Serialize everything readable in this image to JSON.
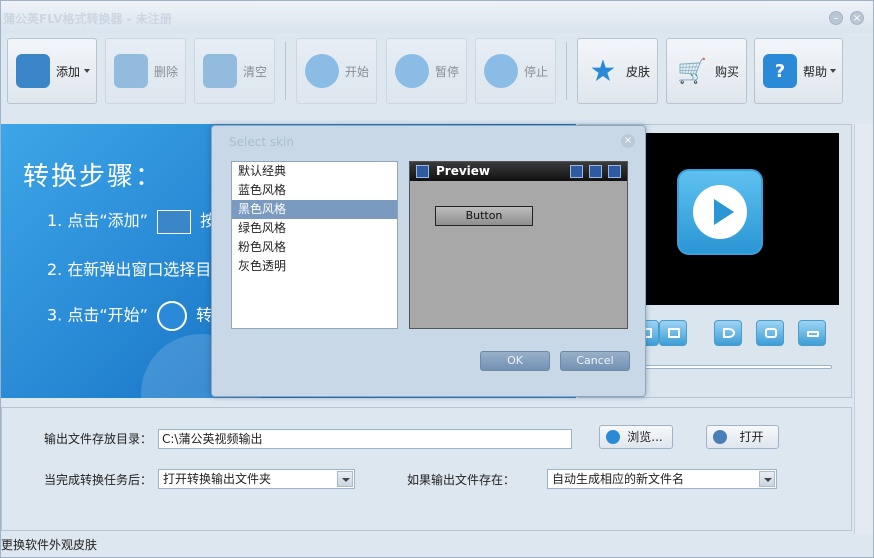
{
  "window": {
    "title": "蒲公英FLV格式转换器 - 未注册",
    "min_btn": "–",
    "close_btn": "×"
  },
  "toolbar": {
    "add": "添加",
    "delete": "删除",
    "clear": "清空",
    "start": "开始",
    "pause": "暂停",
    "stop": "停止",
    "skin": "皮肤",
    "buy": "购买",
    "help": "帮助"
  },
  "steps": {
    "title": "转换步骤：",
    "step1": "1. 点击“添加”",
    "step1_tail": "按",
    "step2": "2. 在新弹出窗口选择目",
    "step3": "3. 点击“开始”",
    "step3_tail": "转"
  },
  "output": {
    "dir_label": "输出文件存放目录：",
    "dir_value": "C:\\蒲公英视频输出",
    "browse": "浏览...",
    "open": "打开",
    "after_label": "当完成转换任务后：",
    "after_value": "打开转换输出文件夹",
    "exists_label": "如果输出文件存在：",
    "exists_value": "自动生成相应的新文件名"
  },
  "status": "更换软件外观皮肤",
  "dialog": {
    "title": "Select skin",
    "skins": [
      "默认经典",
      "蓝色风格",
      "黑色风格",
      "绿色风格",
      "粉色风格",
      "灰色透明"
    ],
    "selected_index": 2,
    "preview_title": "Preview",
    "preview_button": "Button",
    "ok": "OK",
    "cancel": "Cancel"
  },
  "colors": {
    "accent": "#2a8ad8",
    "panel_bg": "#dde7f0",
    "selection": "#7b9ac0"
  }
}
